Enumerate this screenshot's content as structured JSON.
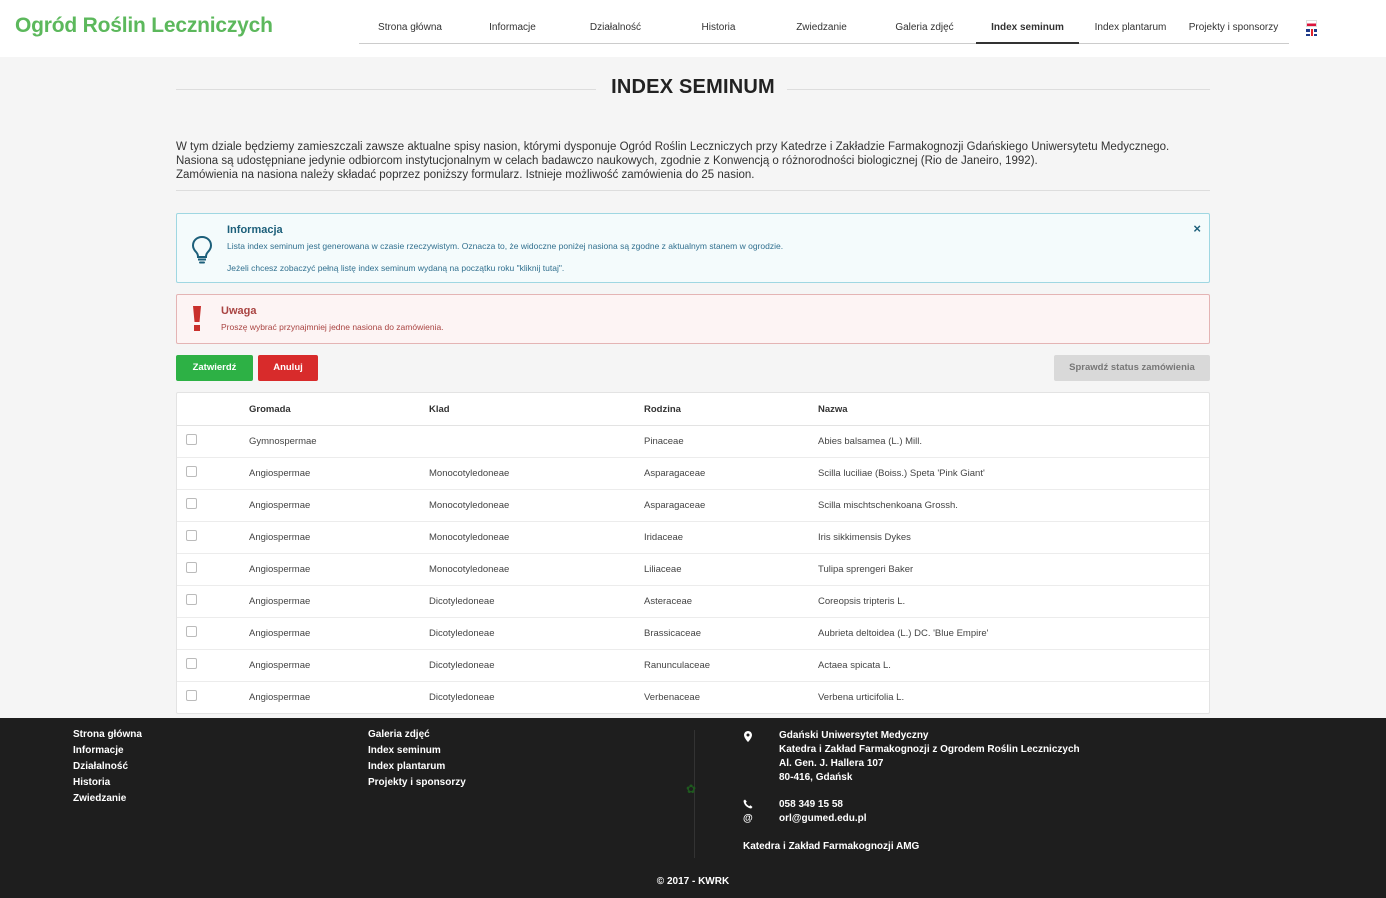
{
  "brand": "Ogród Roślin Leczniczych",
  "nav": [
    "Strona główna",
    "Informacje",
    "Działalność",
    "Historia",
    "Zwiedzanie",
    "Galeria zdjęć",
    "Index seminum",
    "Index plantarum",
    "Projekty i sponsorzy"
  ],
  "nav_active": "Index seminum",
  "page_title": "INDEX SEMINUM",
  "intro": [
    "W tym dziale będziemy zamieszczali zawsze aktualne spisy nasion, którymi dysponuje Ogród Roślin Leczniczych przy Katedrze i Zakładzie Farmakognozji Gdańskiego Uniwersytetu Medycznego.",
    "Nasiona są udostępniane jedynie odbiorcom instytucjonalnym w celach badawczo naukowych, zgodnie z Konwencją o różnorodności biologicznej (Rio de Janeiro, 1992).",
    "Zamówienia na nasiona należy składać poprzez poniższy formularz. Istnieje możliwość zamówienia do 25 nasion."
  ],
  "info_alert": {
    "title": "Informacja",
    "line1": "Lista index seminum jest generowana w czasie rzeczywistym. Oznacza to, że widoczne poniżej nasiona są zgodne z aktualnym stanem w ogrodzie.",
    "line2": "Jeżeli chcesz zobaczyć pełną listę index seminum wydaną na początku roku \"kliknij tutaj\".",
    "close": "×"
  },
  "warn_alert": {
    "title": "Uwaga",
    "line1": "Proszę wybrać przynajmniej jedne nasiona do zamówienia."
  },
  "buttons": {
    "confirm": "Zatwierdź",
    "cancel": "Anuluj",
    "status": "Sprawdź status zamówienia"
  },
  "table": {
    "headers": [
      "Gromada",
      "Klad",
      "Rodzina",
      "Nazwa"
    ],
    "rows": [
      {
        "gromada": "Gymnospermae",
        "klad": "",
        "rodzina": "Pinaceae",
        "nazwa": "Abies balsamea (L.) Mill."
      },
      {
        "gromada": "Angiospermae",
        "klad": "Monocotyledoneae",
        "rodzina": "Asparagaceae",
        "nazwa": "Scilla luciliae (Boiss.) Speta 'Pink Giant'"
      },
      {
        "gromada": "Angiospermae",
        "klad": "Monocotyledoneae",
        "rodzina": "Asparagaceae",
        "nazwa": "Scilla mischtschenkoana Grossh."
      },
      {
        "gromada": "Angiospermae",
        "klad": "Monocotyledoneae",
        "rodzina": "Iridaceae",
        "nazwa": "Iris sikkimensis Dykes"
      },
      {
        "gromada": "Angiospermae",
        "klad": "Monocotyledoneae",
        "rodzina": "Liliaceae",
        "nazwa": "Tulipa sprengeri Baker"
      },
      {
        "gromada": "Angiospermae",
        "klad": "Dicotyledoneae",
        "rodzina": "Asteraceae",
        "nazwa": "Coreopsis tripteris L."
      },
      {
        "gromada": "Angiospermae",
        "klad": "Dicotyledoneae",
        "rodzina": "Brassicaceae",
        "nazwa": "Aubrieta deltoidea (L.) DC. 'Blue Empire'"
      },
      {
        "gromada": "Angiospermae",
        "klad": "Dicotyledoneae",
        "rodzina": "Ranunculaceae",
        "nazwa": "Actaea spicata L."
      },
      {
        "gromada": "Angiospermae",
        "klad": "Dicotyledoneae",
        "rodzina": "Verbenaceae",
        "nazwa": "Verbena urticifolia L."
      }
    ]
  },
  "footer": {
    "col1": [
      "Strona główna",
      "Informacje",
      "Działalność",
      "Historia",
      "Zwiedzanie"
    ],
    "col2": [
      "Galeria zdjęć",
      "Index seminum",
      "Index plantarum",
      "Projekty i sponsorzy"
    ],
    "address": [
      "Gdański Uniwersytet Medyczny",
      "Katedra i Zakład Farmakognozji z Ogrodem Roślin Leczniczych",
      "Al. Gen. J. Hallera 107",
      "80-416, Gdańsk"
    ],
    "phone": "058 349 15 58",
    "email": "orl@gumed.edu.pl",
    "department": "Katedra i Zakład Farmakognozji AMG",
    "copyright": "© 2017 - KWRK"
  },
  "colors": {
    "brand": "#5cb85c",
    "confirm": "#2db145",
    "cancel": "#d82b2b",
    "info_border": "#9fd7e2",
    "warn_border": "#e4b4b4",
    "footer_bg": "#1e1e1e"
  },
  "icons": {
    "info": "lightbulb-icon",
    "warning": "exclamation-icon",
    "address": "map-marker-icon",
    "phone": "phone-icon",
    "email": "at-icon",
    "leaf": "leaf-icon"
  }
}
